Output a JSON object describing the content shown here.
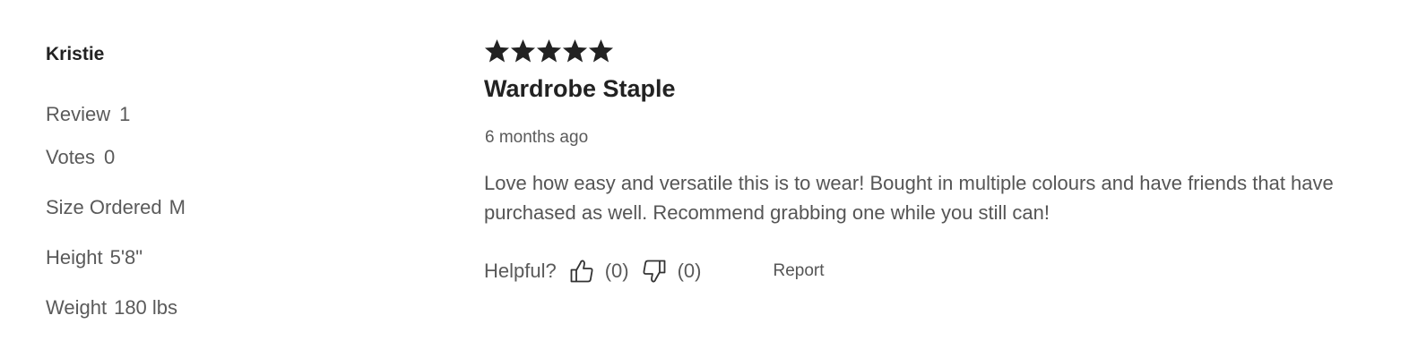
{
  "reviewer": {
    "name": "Kristie",
    "stats": [
      {
        "label": "Review",
        "value": "1"
      },
      {
        "label": "Votes",
        "value": "0"
      },
      {
        "label": "Size Ordered",
        "value": "M"
      },
      {
        "label": "Height",
        "value": "5'8\""
      },
      {
        "label": "Weight",
        "value": "180 lbs"
      }
    ]
  },
  "review": {
    "rating": 5,
    "rating_max": 5,
    "title": "Wardrobe Staple",
    "date": "6 months ago",
    "text": "Love how easy and versatile this is to wear! Bought in multiple colours and have friends that have purchased as well. Recommend grabbing one while you still can!"
  },
  "helpful": {
    "label": "Helpful?",
    "up_icon": "thumbs-up-icon",
    "up_count": "(0)",
    "down_icon": "thumbs-down-icon",
    "down_count": "(0)",
    "report_label": "Report"
  },
  "colors": {
    "text_dark": "#222222",
    "text_muted": "#5a5a5a",
    "star": "#222222",
    "background": "#ffffff"
  }
}
